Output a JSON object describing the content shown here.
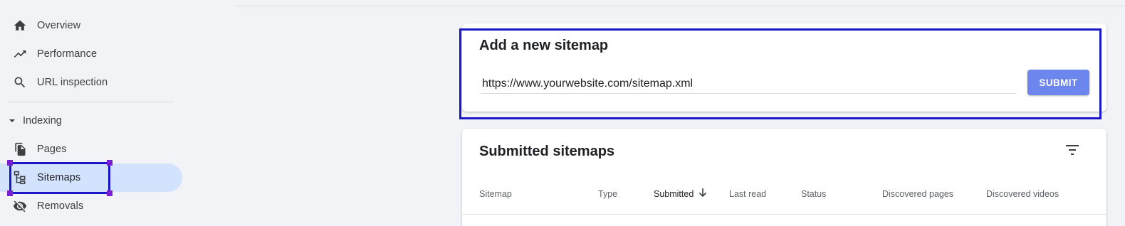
{
  "sidebar": {
    "items": [
      {
        "label": "Overview",
        "icon": "home-icon"
      },
      {
        "label": "Performance",
        "icon": "trending-up-icon"
      },
      {
        "label": "URL inspection",
        "icon": "search-icon"
      }
    ],
    "section": {
      "label": "Indexing",
      "icon": "caret-down-icon"
    },
    "section_items": [
      {
        "label": "Pages",
        "icon": "pages-icon"
      },
      {
        "label": "Sitemaps",
        "icon": "sitemap-icon",
        "active": true
      },
      {
        "label": "Removals",
        "icon": "eye-off-icon"
      }
    ]
  },
  "add_sitemap": {
    "title": "Add a new sitemap",
    "input_value": "https://www.yourwebsite.com/sitemap.xml",
    "submit_label": "SUBMIT"
  },
  "submitted_sitemaps": {
    "title": "Submitted sitemaps",
    "filter_icon": "filter-icon",
    "columns": [
      "Sitemap",
      "Type",
      "Submitted",
      "Last read",
      "Status",
      "Discovered pages",
      "Discovered videos"
    ],
    "sorted_column": "Submitted",
    "sort_icon": "arrow-down-icon"
  },
  "colors": {
    "highlight_border": "#1a17c9",
    "active_nav_bg": "#d3e3fd",
    "submit_bg": "#6c86ee",
    "handle": "#7a1fd0"
  }
}
